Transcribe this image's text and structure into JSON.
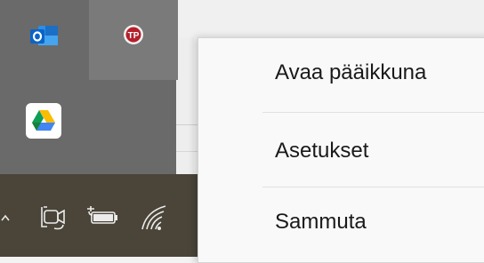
{
  "context_menu": {
    "items": [
      {
        "label": "Avaa pääikkuna"
      },
      {
        "label": "Asetukset"
      },
      {
        "label": "Sammuta"
      }
    ]
  },
  "tray_overflow": {
    "icons": [
      "outlook-icon",
      "tp-app-icon",
      "google-drive-icon"
    ]
  },
  "taskbar": {
    "icons": [
      "chevron-up-icon",
      "camera-icon",
      "battery-icon",
      "wifi-icon"
    ]
  },
  "colors": {
    "overflow_bg": "#6a6a6a",
    "taskbar_bg": "#4a4538",
    "menu_bg": "#f9f9f9",
    "outlook_blue": "#0a64c8",
    "tp_red": "#b41f2a"
  }
}
